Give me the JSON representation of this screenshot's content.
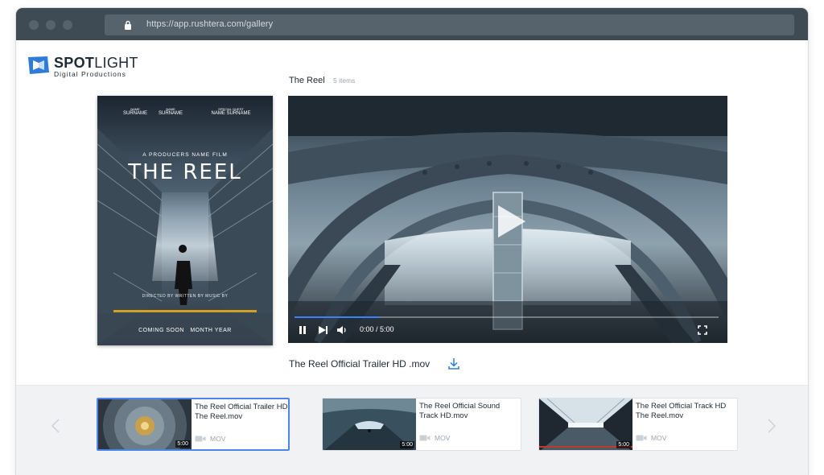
{
  "browser": {
    "url": "https://app.rushtera.com/gallery"
  },
  "brand": {
    "name_bold": "SPOT",
    "name_light": "LIGHT",
    "tagline": "Digital Productions",
    "accent": "#2f7bd8"
  },
  "gallery": {
    "title": "The Reel",
    "count": "5 items"
  },
  "poster": {
    "credits": [
      {
        "role": "NAME",
        "name": "SURNAME"
      },
      {
        "role": "NAME",
        "name": "SURNAME"
      },
      {
        "role": "SPECIAL GUEST",
        "name": "NAME SURNAME"
      }
    ],
    "tagline": "A PRODUCERS NAME FILM",
    "title": "THE REEL",
    "footer_credits": "DIRECTED BY  WRITTEN BY  MUSIC BY",
    "coming": "COMING SOON",
    "month": "MONTH YEAR"
  },
  "player": {
    "time": "0:00 / 5:00",
    "progress": 0.0,
    "buffered": 0.2,
    "icons": [
      "play-icon",
      "pause-icon",
      "next-icon",
      "volume-icon",
      "fullscreen-icon"
    ]
  },
  "current_file": {
    "title": "The Reel Official Trailer HD .mov"
  },
  "playlist": [
    {
      "name": "The Reel Official Trailer HD The Reel.mov",
      "duration": "5:00",
      "type": "MOV",
      "selected": true
    },
    {
      "name": "The Reel Official Sound Track HD.mov",
      "duration": "5:00",
      "type": "MOV",
      "selected": false
    },
    {
      "name": "The Reel Official Track HD The Reel.mov",
      "duration": "5:00",
      "type": "MOV",
      "selected": false
    }
  ]
}
